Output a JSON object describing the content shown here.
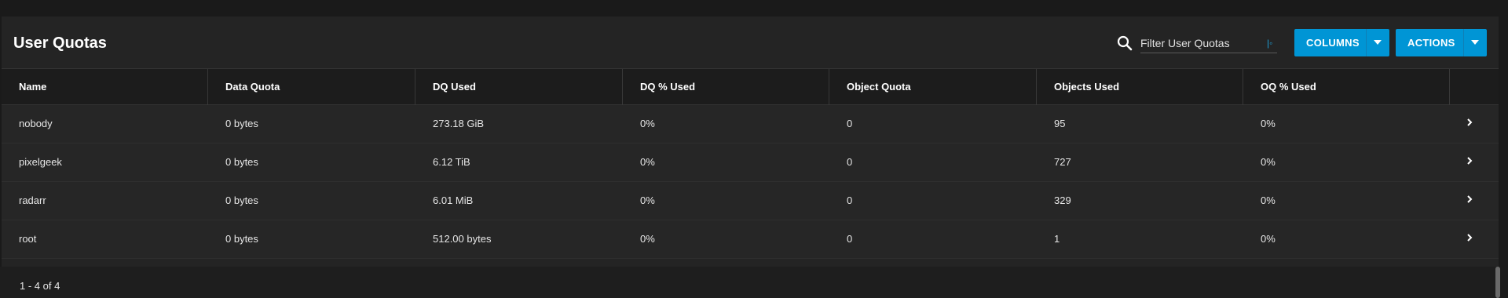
{
  "card": {
    "title": "User Quotas"
  },
  "search": {
    "placeholder": "Filter User Quotas",
    "value": ""
  },
  "toolbar": {
    "columns_label": "COLUMNS",
    "actions_label": "ACTIONS"
  },
  "colors": {
    "accent": "#0095d5",
    "background": "#1a1a1a",
    "card": "#242424"
  },
  "table": {
    "headers": [
      "Name",
      "Data Quota",
      "DQ Used",
      "DQ % Used",
      "Object Quota",
      "Objects Used",
      "OQ % Used"
    ],
    "rows": [
      {
        "name": "nobody",
        "data_quota": "0 bytes",
        "dq_used": "273.18 GiB",
        "dq_pct": "0%",
        "object_quota": "0",
        "objects_used": "95",
        "oq_pct": "0%"
      },
      {
        "name": "pixelgeek",
        "data_quota": "0 bytes",
        "dq_used": "6.12 TiB",
        "dq_pct": "0%",
        "object_quota": "0",
        "objects_used": "727",
        "oq_pct": "0%"
      },
      {
        "name": "radarr",
        "data_quota": "0 bytes",
        "dq_used": "6.01 MiB",
        "dq_pct": "0%",
        "object_quota": "0",
        "objects_used": "329",
        "oq_pct": "0%"
      },
      {
        "name": "root",
        "data_quota": "0 bytes",
        "dq_used": "512.00 bytes",
        "dq_pct": "0%",
        "object_quota": "0",
        "objects_used": "1",
        "oq_pct": "0%"
      }
    ]
  },
  "footer": {
    "page_info": "1 - 4 of 4"
  },
  "icons": {
    "search": "search-icon",
    "dropdown": "caret-down-icon",
    "row_expand": "chevron-right-icon"
  }
}
